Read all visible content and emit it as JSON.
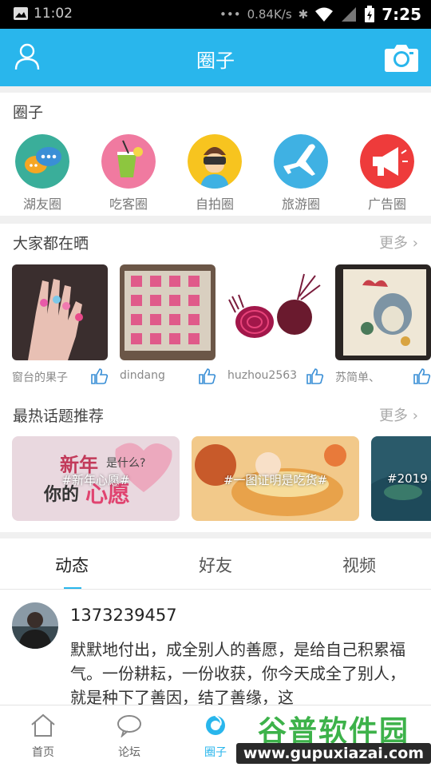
{
  "status_bar": {
    "left_time": "11:02",
    "speed": "0.84K/s",
    "time": "7:25"
  },
  "header": {
    "title": "圈子"
  },
  "circles": {
    "title": "圈子",
    "items": [
      {
        "label": "湖友圈",
        "icon": "chat-bubbles-icon",
        "color": "#3aae9a"
      },
      {
        "label": "吃客圈",
        "icon": "drink-icon",
        "color": "#f07aa0"
      },
      {
        "label": "自拍圈",
        "icon": "vr-person-icon",
        "color": "#f7c41f"
      },
      {
        "label": "旅游圈",
        "icon": "airplane-icon",
        "color": "#3fb1e3"
      },
      {
        "label": "广告圈",
        "icon": "megaphone-icon",
        "color": "#ee3b3b"
      }
    ]
  },
  "showcase": {
    "title": "大家都在晒",
    "more": "更多",
    "items": [
      {
        "caption": "窗台的果子"
      },
      {
        "caption": "dindang"
      },
      {
        "caption": "huzhou2563"
      },
      {
        "caption": "苏简单、"
      }
    ]
  },
  "topics": {
    "title": "最热话题推荐",
    "more": "更多",
    "items": [
      {
        "caption": "#新年心愿#",
        "art_text": "新年 是什么? 你的心愿"
      },
      {
        "caption": "#一图证明是吃货#"
      },
      {
        "caption": "#2019"
      }
    ]
  },
  "tabs": {
    "items": [
      "动态",
      "好友",
      "视频"
    ],
    "active": 0
  },
  "post": {
    "user": "1373239457",
    "text": "默默地付出，成全别人的善愿，是给自己积累福气。一份耕耘，一份收获，你今天成全了别人，就是种下了善因，结了善缘，这"
  },
  "bottom_nav": {
    "items": [
      {
        "label": "首页",
        "icon": "home-icon"
      },
      {
        "label": "论坛",
        "icon": "chat-icon"
      },
      {
        "label": "圈子",
        "icon": "circle-icon"
      }
    ]
  },
  "watermark": {
    "big": "谷普软件园",
    "small": "www.gupuxiazai.com"
  },
  "colors": {
    "accent": "#29b6ec",
    "divider": "#f0f0f0"
  }
}
